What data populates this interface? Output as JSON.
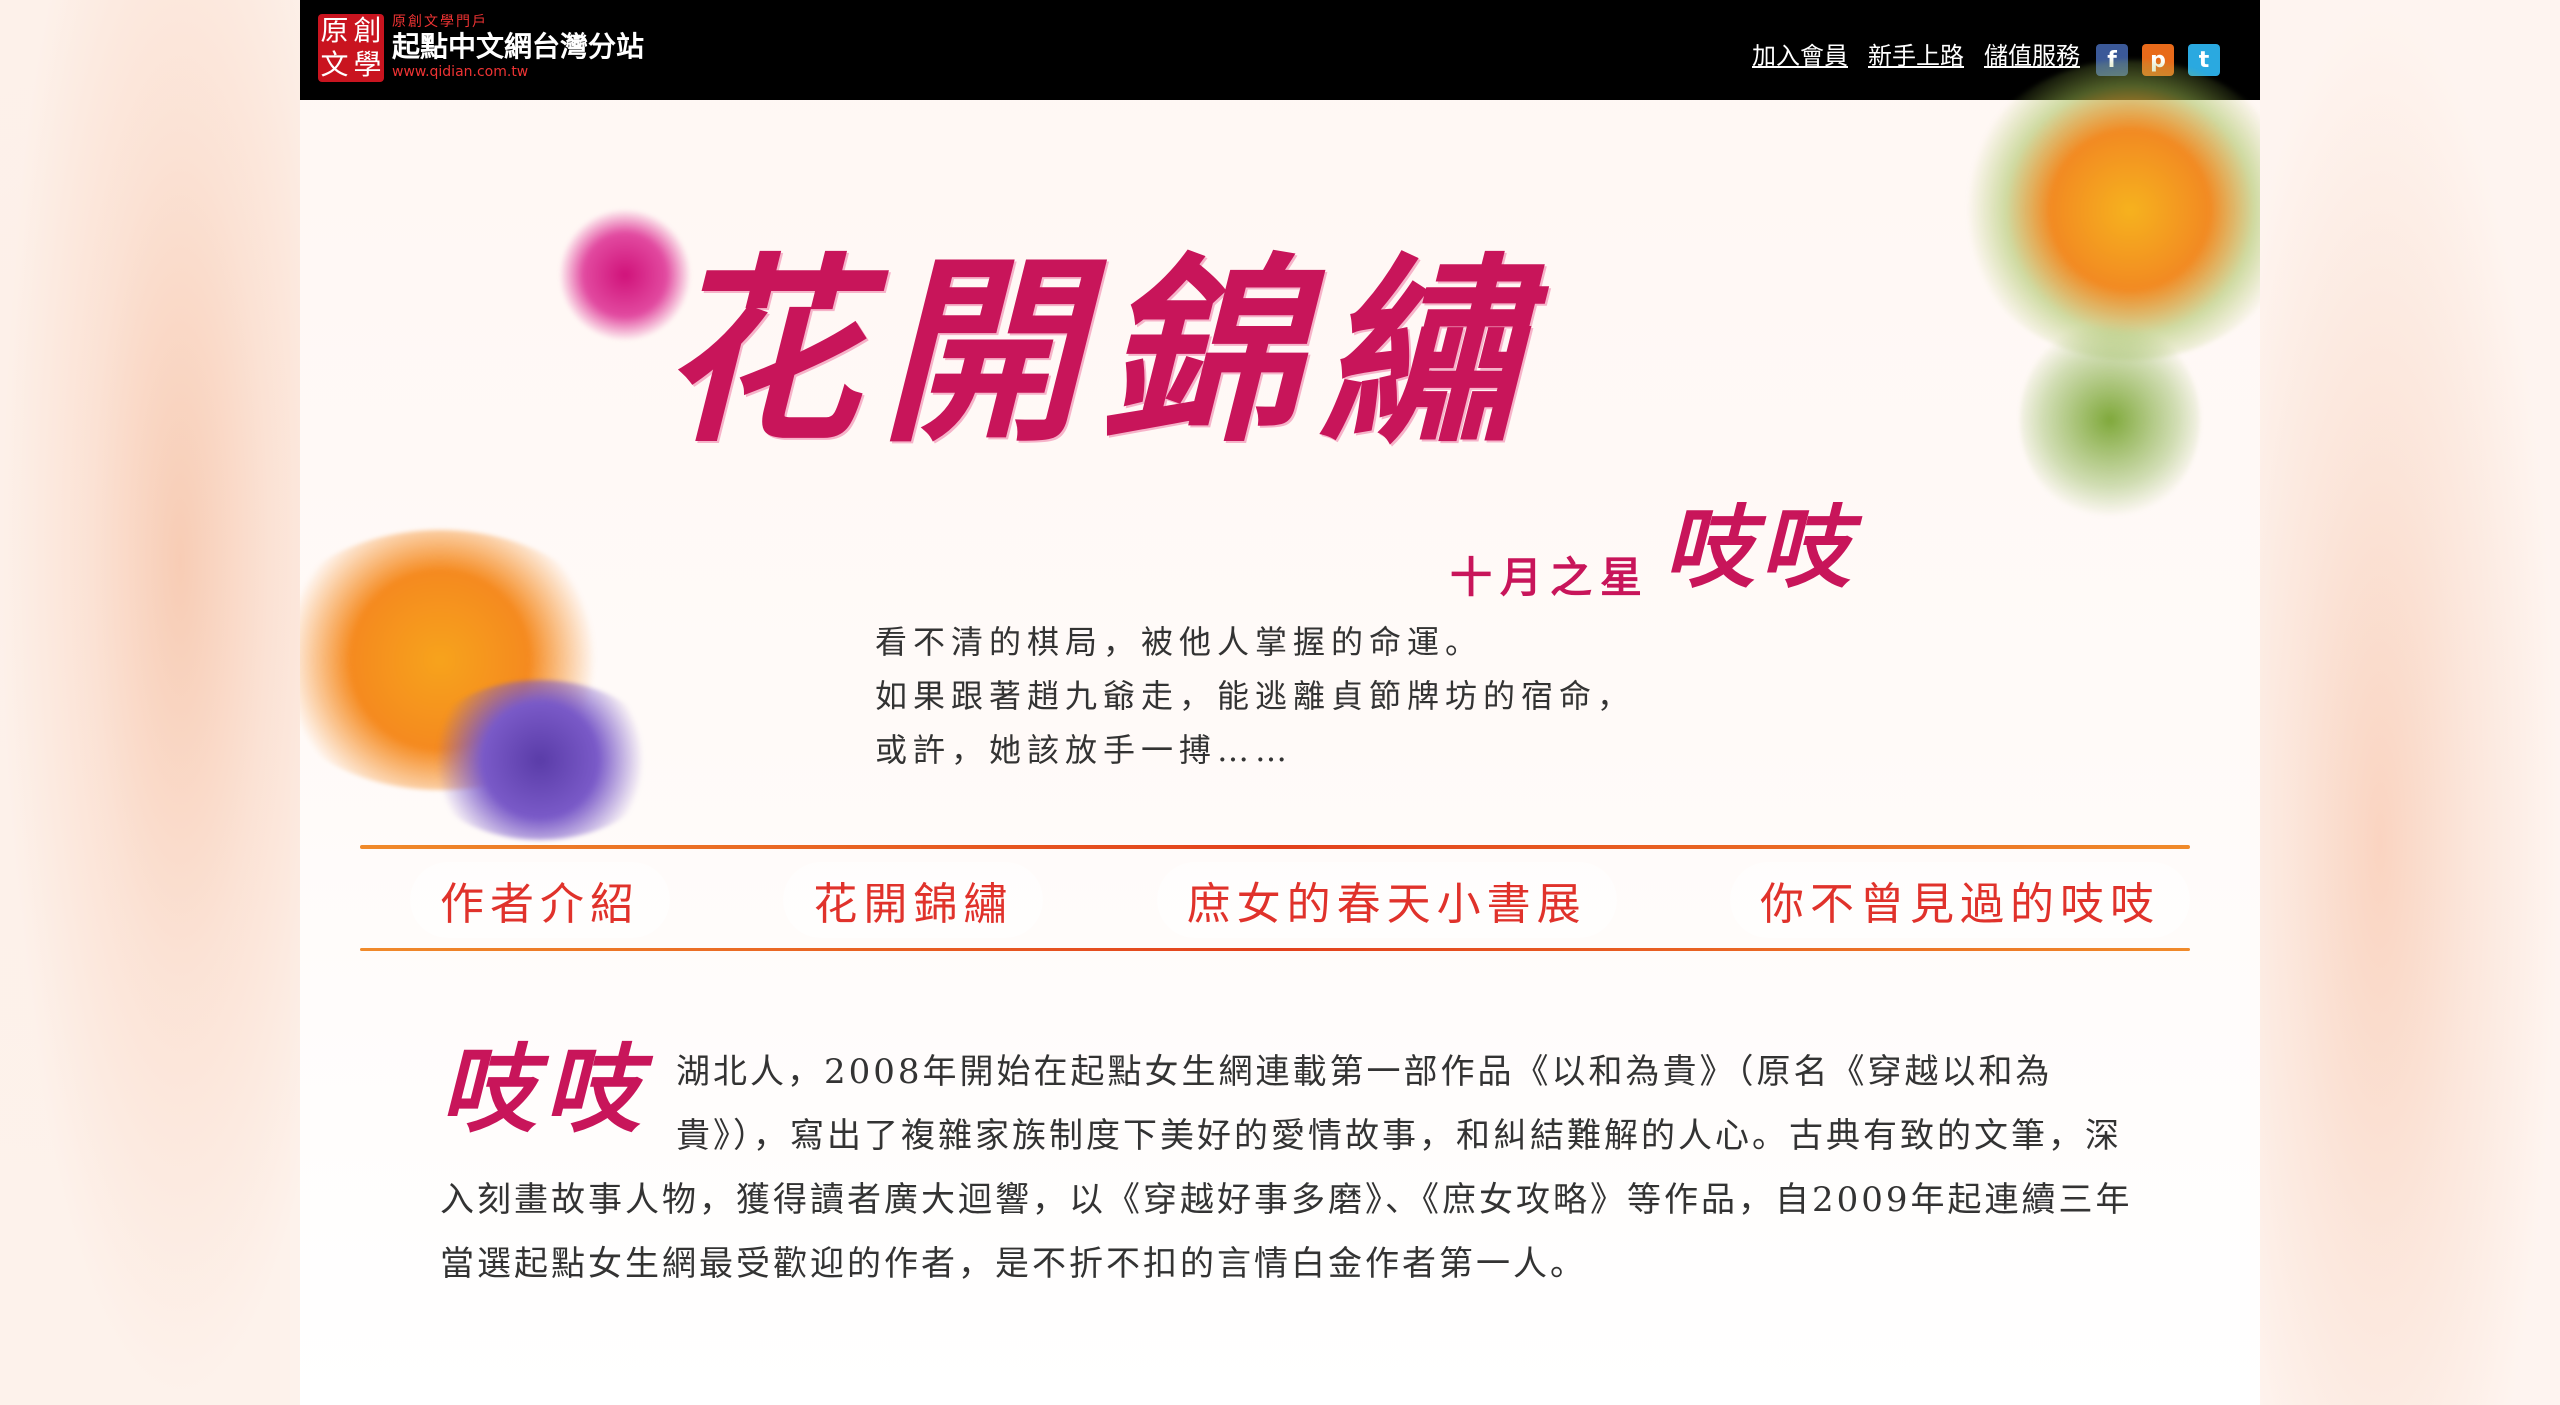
{
  "header": {
    "logo_seal": [
      "原",
      "創",
      "文",
      "學"
    ],
    "logo_small": "原創文學門戶",
    "logo_main": "起點中文網台灣分站",
    "logo_url": "www.qidian.com.tw",
    "links": [
      "加入會員",
      "新手上路",
      "儲值服務"
    ],
    "social": [
      {
        "icon": "facebook-icon",
        "glyph": "f"
      },
      {
        "icon": "plurk-icon",
        "glyph": "p"
      },
      {
        "icon": "twitter-icon",
        "glyph": "t"
      }
    ]
  },
  "hero": {
    "title": "花開錦繡",
    "month": "十月之星",
    "star_name": "吱吱",
    "intro": [
      "看不清的棋局，被他人掌握的命運。",
      "如果跟著趙九爺走，能逃離貞節牌坊的宿命，",
      "或許，她該放手一搏……"
    ]
  },
  "nav": [
    "作者介紹",
    "花開錦繡",
    "庶女的春天小書展",
    "你不曾見過的吱吱"
  ],
  "bio": {
    "name": "吱吱",
    "text": "湖北人，2008年開始在起點女生網連載第一部作品《以和為貴》（原名《穿越以和為貴》），寫出了複雜家族制度下美好的愛情故事，和糾結難解的人心。古典有致的文筆，深入刻畫故事人物，獲得讀者廣大迴響，以《穿越好事多磨》、《庶女攻略》等作品，自2009年起連續三年當選起點女生網最受歡迎的作者，是不折不扣的言情白金作者第一人。"
  },
  "colors": {
    "accent": "#c8155a",
    "nav_text": "#e0322b",
    "topbar": "#000000"
  }
}
